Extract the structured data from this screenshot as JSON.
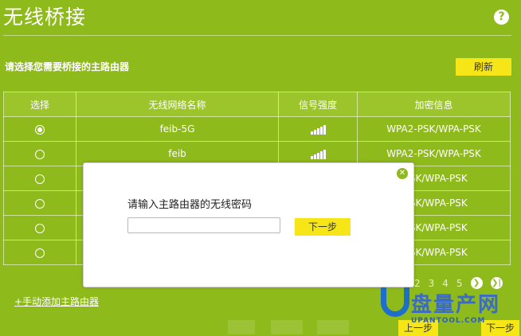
{
  "header": {
    "title": "无线桥接",
    "help_icon": "question-icon"
  },
  "instruction": "请选择您需要桥接的主路由器",
  "refresh_label": "刷新",
  "table": {
    "headers": [
      "选择",
      "无线网络名称",
      "信号强度",
      "加密信息"
    ],
    "rows": [
      {
        "selected": true,
        "ssid": "feib-5G",
        "signal": 5,
        "encryption": "WPA2-PSK/WPA-PSK"
      },
      {
        "selected": false,
        "ssid": "feib",
        "signal": 5,
        "encryption": "WPA2-PSK/WPA-PSK"
      },
      {
        "selected": false,
        "ssid": "",
        "signal": 0,
        "encryption": "-PSK/WPA-PSK"
      },
      {
        "selected": false,
        "ssid": "",
        "signal": 0,
        "encryption": "-PSK/WPA-PSK"
      },
      {
        "selected": false,
        "ssid": "",
        "signal": 0,
        "encryption": "-PSK/WPA-PSK"
      },
      {
        "selected": false,
        "ssid": "",
        "signal": 0,
        "encryption": "-PSK/WPA-PSK"
      }
    ]
  },
  "manual_add_label": "+手动添加主路由器",
  "pagination": {
    "pages": [
      "2",
      "3",
      "4",
      "5"
    ],
    "next_icon": "chevron-right-icon",
    "last_icon": "last-page-icon"
  },
  "buttons": {
    "prev_label": "上一步",
    "next_label": "下一步"
  },
  "watermark": {
    "brand": "盘量产网",
    "url": "UPANTOOL.COM"
  },
  "modal": {
    "prompt": "请输入主路由器的无线密码",
    "password_value": "",
    "next_label": "下一步",
    "close_icon": "close-icon"
  },
  "colors": {
    "background": "#8fba1b",
    "button": "#f6e617"
  }
}
